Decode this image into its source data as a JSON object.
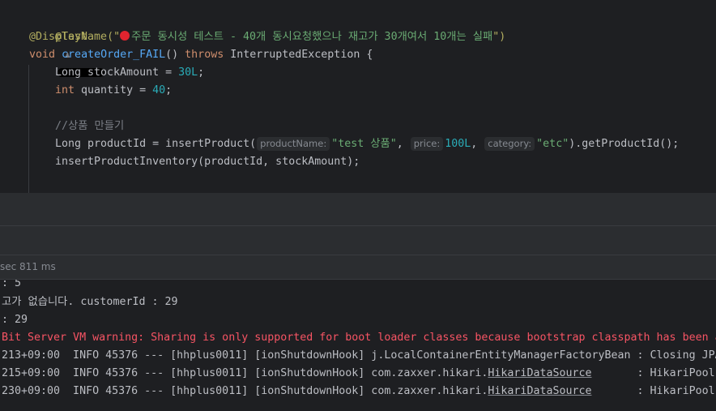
{
  "editor": {
    "test_annotation": "@Test",
    "display_name_prefix": "@DisplayName(\"",
    "display_name_text": "주문 동시성 테스트 - 40개 동시요청했으나 재고가 30개여서 10개는 실패",
    "display_name_suffix": "\")",
    "method_kw_void": "void",
    "method_name": "createOrder_FAIL",
    "method_parens": "() ",
    "method_kw_throws": "throws",
    "method_exception": " InterruptedException {",
    "line_stock_decl": "Long stockAmount = ",
    "line_stock_value": "30L",
    "line_end": ";",
    "line_qty_kw": "int",
    "line_qty_decl": " quantity = ",
    "line_qty_value": "40",
    "comment": "//상품 만들기",
    "line_product_decl": "Long productId = insertProduct(",
    "hint_product_name": "productName:",
    "arg_product_name": "\"test 상품\"",
    "comma": ", ",
    "hint_price": "price:",
    "arg_price": "100L",
    "hint_category": "category:",
    "arg_category": "\"etc\"",
    "line_product_tail": ").getProductId();",
    "line_inventory": "insertProductInventory(productId, stockAmount);"
  },
  "status": {
    "duration": "sec 811 ms"
  },
  "console": {
    "line1": ": 5",
    "line2": "고가 없습니다. customerId : 29",
    "line3": ": 29",
    "line4": "Bit Server VM warning: Sharing is only supported for boot loader classes because bootstrap classpath has been a",
    "line5": "213+09:00  INFO 45376 --- [hhplus0011] [ionShutdownHook] j.LocalContainerEntityManagerFactoryBean : Closing JPA",
    "line6_prefix": "215+09:00  INFO 45376 --- [hhplus0011] [ionShutdownHook] com.zaxxer.hikari.",
    "line6_link": "HikariDataSource",
    "line6_suffix": "       : HikariPool-",
    "line7_prefix": "230+09:00  INFO 45376 --- [hhplus0011] [ionShutdownHook] com.zaxxer.hikari.",
    "line7_link": "HikariDataSource",
    "line7_suffix": "       : HikariPool-"
  },
  "colors": {
    "background": "#1e1f22",
    "panel": "#2b2d30",
    "annotation": "#b3ae60",
    "string": "#6aab73",
    "keyword": "#cf8e6d",
    "function": "#56a8f5",
    "number": "#2aacb8",
    "error": "#f75464"
  }
}
